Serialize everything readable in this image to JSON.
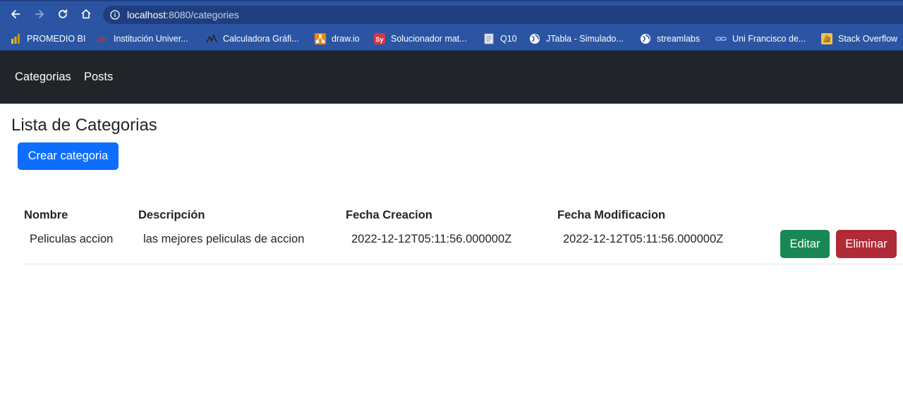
{
  "browser": {
    "url_host": "localhost",
    "url_rest": ":8080/categories",
    "bookmarks": [
      {
        "label": "PROMEDIO BI",
        "icon": "powerbi-icon"
      },
      {
        "label": "Institución Univer...",
        "icon": "institution-icon"
      },
      {
        "label": "Calculadora Gráfi...",
        "icon": "calculator-graph-icon"
      },
      {
        "label": "draw.io",
        "icon": "drawio-icon"
      },
      {
        "label": "Solucionador mat...",
        "icon": "sy-icon"
      },
      {
        "label": "Q10",
        "icon": "document-icon"
      },
      {
        "label": "JTabla - Simulado...",
        "icon": "globe-icon"
      },
      {
        "label": "streamlabs",
        "icon": "globe-icon"
      },
      {
        "label": "Uni Francisco de...",
        "icon": "link-icon"
      },
      {
        "label": "Stack Overflow",
        "icon": "stackoverflow-icon"
      }
    ]
  },
  "navbar": {
    "links": [
      "Categorias",
      "Posts"
    ]
  },
  "page": {
    "title": "Lista de Categorias",
    "create_button": "Crear categoria"
  },
  "table": {
    "headers": [
      "Nombre",
      "Descripción",
      "Fecha Creacion",
      "Fecha Modificacion"
    ],
    "rows": [
      {
        "nombre": "Peliculas accion",
        "descripcion": "las mejores peliculas de accion",
        "fecha_creacion": "2022-12-12T05:11:56.000000Z",
        "fecha_modificacion": "2022-12-12T05:11:56.000000Z",
        "edit_label": "Editar",
        "delete_label": "Eliminar"
      }
    ]
  },
  "colors": {
    "primary": "#0d6efd",
    "success": "#198754",
    "danger": "#b02a37",
    "navbar": "#212529",
    "browser_chrome": "#2b55a3"
  }
}
